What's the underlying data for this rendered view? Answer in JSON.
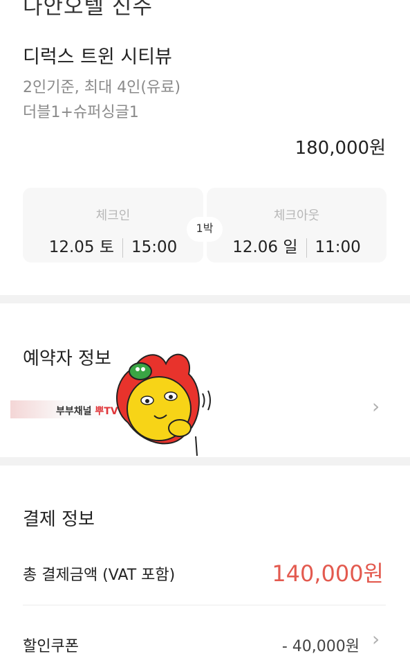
{
  "hotel": {
    "name": "다안오텔 신주",
    "room_name": "디럭스 트윈 시티뷰",
    "capacity": "2인기준, 최대 4인(유료)",
    "bed": "더블1+슈퍼싱글1",
    "price": "180,000원"
  },
  "stay": {
    "checkin_label": "체크인",
    "checkin_date": "12.05 토",
    "checkin_time": "15:00",
    "checkout_label": "체크아웃",
    "checkout_date": "12.06 일",
    "checkout_time": "11:00",
    "nights": "1박"
  },
  "reserver": {
    "title": "예약자 정보",
    "watermark_black": "부부채널 ",
    "watermark_red": "뿌TV"
  },
  "payment": {
    "title": "결제 정보",
    "total_label": "총 결제금액 (VAT 포함)",
    "total_value": "140,000원",
    "coupon_label": "할인쿠폰",
    "coupon_value": "- 40,000원"
  },
  "icons": {
    "chevron": "chevron-right-icon"
  },
  "colors": {
    "accent": "#e35a4f",
    "muted": "#8a8a8a",
    "divider": "#f2f2f2"
  }
}
